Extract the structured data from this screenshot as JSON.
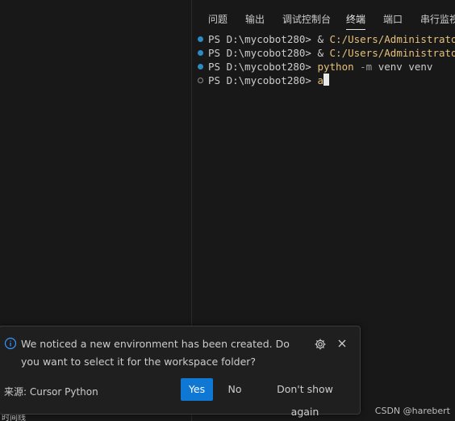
{
  "panel": {
    "tabs": [
      {
        "label": "问题",
        "active": false
      },
      {
        "label": "输出",
        "active": false
      },
      {
        "label": "调试控制台",
        "active": false
      },
      {
        "label": "终端",
        "active": true
      },
      {
        "label": "端口",
        "active": false
      },
      {
        "label": "串行监视器",
        "active": false
      }
    ]
  },
  "terminal": {
    "lines": [
      {
        "status": "ok",
        "prompt": "PS D:\\mycobot280> ",
        "segments": [
          "& ",
          "C:/Users/Administrator/A"
        ]
      },
      {
        "status": "ok",
        "prompt": "PS D:\\mycobot280> ",
        "segments": [
          "& ",
          "C:/Users/Administrator/A"
        ]
      },
      {
        "status": "ok",
        "prompt": "PS D:\\mycobot280> ",
        "segments": [
          "python",
          " -m",
          " venv venv"
        ]
      },
      {
        "status": "pending",
        "prompt": "PS D:\\mycobot280> ",
        "segments": [
          "a"
        ]
      }
    ]
  },
  "notification": {
    "icon": "info-icon",
    "message": "We noticed a new environment has been created. Do you want to select it for the workspace folder?",
    "source": "来源: Cursor Python",
    "buttons": {
      "yes": "Yes",
      "no": "No",
      "dont_show": "Don't show again"
    }
  },
  "left_clipped_text": "时间线",
  "watermark": "CSDN @harebert",
  "colors": {
    "background": "#181818",
    "accent_blue": "#0e78d4",
    "path_yellow": "#e5c07b",
    "decoration_ok": "#2b8bc2"
  }
}
